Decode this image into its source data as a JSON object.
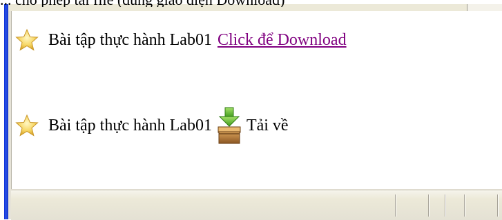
{
  "top_caption": "... cho phép tải file (dùng giao diện Download)",
  "links": [
    {
      "prefix": "Bài tập thực hành Lab01",
      "link_text": "Click để Download"
    },
    {
      "prefix": "Bài tập thực hành Lab01",
      "download_text": "Tải về"
    }
  ],
  "icons": {
    "bullet": "star-icon",
    "download": "download-box-icon"
  },
  "colors": {
    "visited_link": "#800080",
    "window_border": "#0b2fd6",
    "statusbar": "#ece9d8"
  },
  "statusbar": {
    "text": ""
  }
}
